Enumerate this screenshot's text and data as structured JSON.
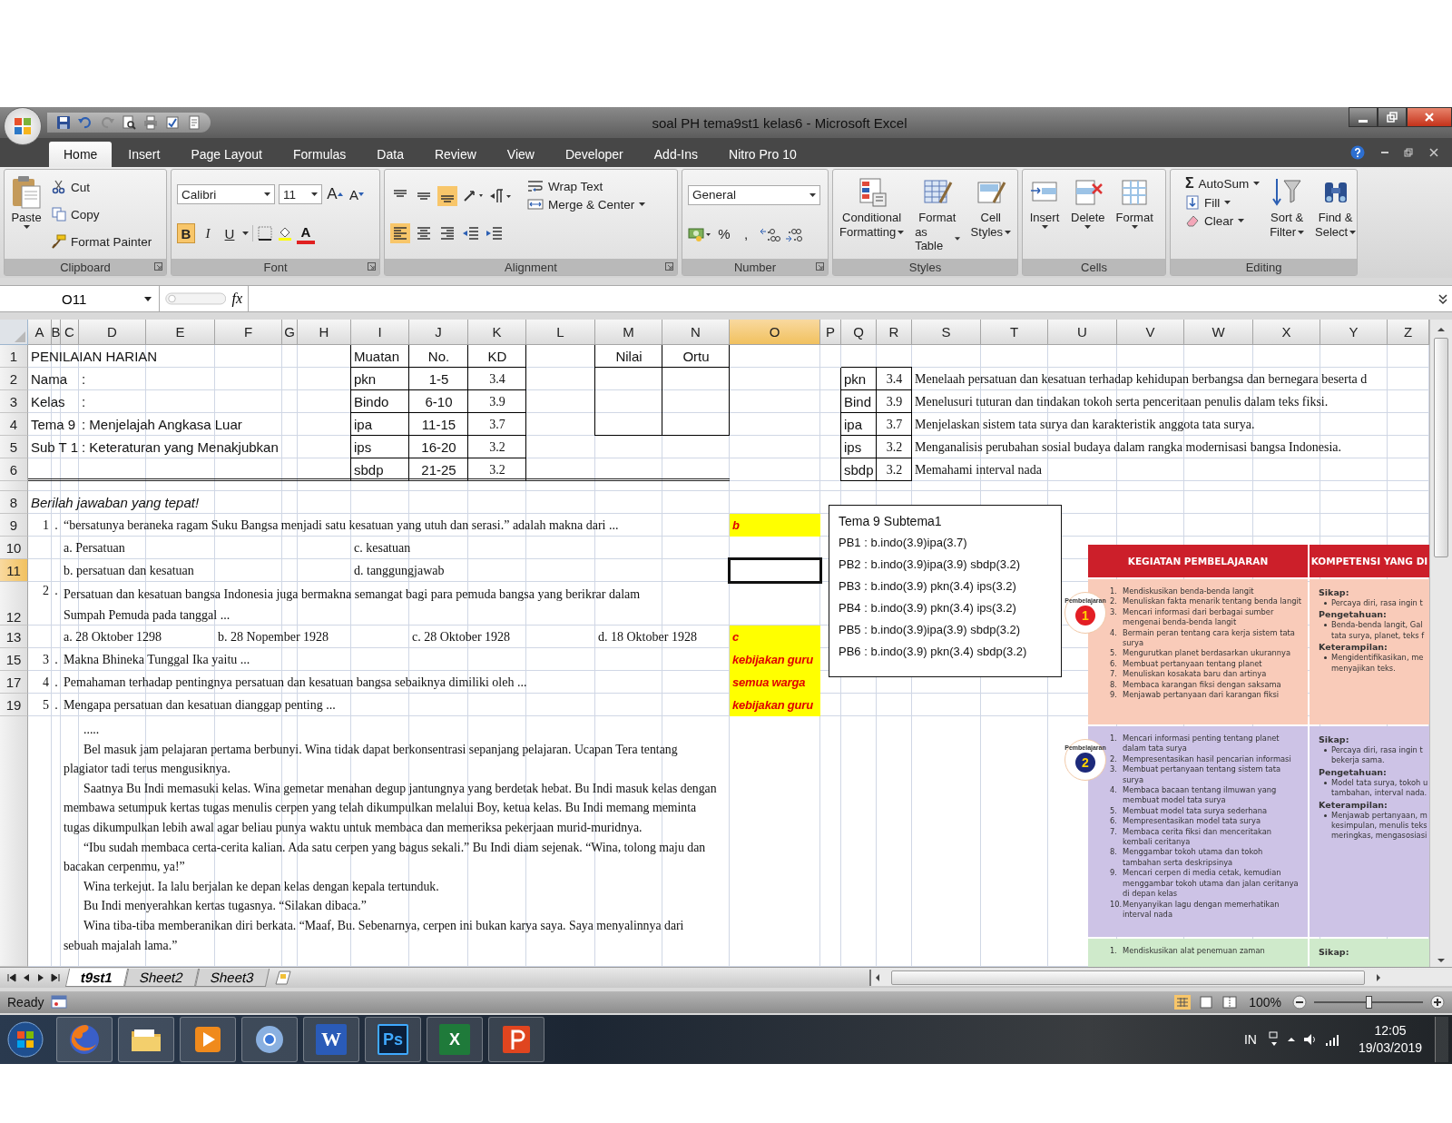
{
  "window": {
    "title": "soal PH tema9st1 kelas6 - Microsoft Excel"
  },
  "ribbon_tabs": [
    {
      "label": "Home",
      "selected": true
    },
    {
      "label": "Insert",
      "selected": false
    },
    {
      "label": "Page Layout",
      "selected": false
    },
    {
      "label": "Formulas",
      "selected": false
    },
    {
      "label": "Data",
      "selected": false
    },
    {
      "label": "Review",
      "selected": false
    },
    {
      "label": "View",
      "selected": false
    },
    {
      "label": "Developer",
      "selected": false
    },
    {
      "label": "Add-Ins",
      "selected": false
    },
    {
      "label": "Nitro Pro 10",
      "selected": false
    }
  ],
  "ribbon": {
    "clipboard": {
      "title": "Clipboard",
      "paste": "Paste",
      "cut": "Cut",
      "copy": "Copy",
      "format_painter": "Format Painter"
    },
    "font": {
      "title": "Font",
      "family": "Calibri",
      "size": "11",
      "grow": "A",
      "shrink": "A",
      "bold": {
        "glyph": "B",
        "on": true
      },
      "italic": {
        "glyph": "I",
        "on": false
      },
      "underline": {
        "glyph": "U",
        "on": false
      },
      "font_color": "A"
    },
    "alignment": {
      "title": "Alignment",
      "vertical": [
        {
          "selected": false
        },
        {
          "selected": false
        },
        {
          "selected": true
        }
      ],
      "horizontal": [
        {
          "selected": true
        },
        {
          "selected": false
        },
        {
          "selected": false
        }
      ],
      "wrap_text": "Wrap Text",
      "merge_center": "Merge & Center"
    },
    "number": {
      "title": "Number",
      "format": "General",
      "percent": "%",
      "comma": ","
    },
    "styles": {
      "title": "Styles",
      "buttons": [
        {
          "lines": [
            "Conditional",
            "Formatting"
          ]
        },
        {
          "lines": [
            "Format",
            "as Table"
          ]
        },
        {
          "lines": [
            "Cell",
            "Styles"
          ]
        }
      ]
    },
    "cells": {
      "title": "Cells",
      "buttons": [
        "Insert",
        "Delete",
        "Format"
      ]
    },
    "editing": {
      "title": "Editing",
      "autosum_glyph": "Σ",
      "autosum": "AutoSum",
      "fill": "Fill",
      "clear": "Clear",
      "sort": [
        "Sort &",
        "Filter"
      ],
      "find": [
        "Find &",
        "Select"
      ]
    }
  },
  "formula_bar": {
    "name_box": "O11",
    "function_glyph": "fx"
  },
  "sheet": {
    "columns": [
      {
        "label": "A",
        "selected": false
      },
      {
        "label": "B",
        "selected": false
      },
      {
        "label": "C",
        "selected": false
      },
      {
        "label": "D",
        "selected": false
      },
      {
        "label": "E",
        "selected": false
      },
      {
        "label": "F",
        "selected": false
      },
      {
        "label": "G",
        "selected": false
      },
      {
        "label": "H",
        "selected": false
      },
      {
        "label": "I",
        "selected": false
      },
      {
        "label": "J",
        "selected": false
      },
      {
        "label": "K",
        "selected": false
      },
      {
        "label": "L",
        "selected": false
      },
      {
        "label": "M",
        "selected": false
      },
      {
        "label": "N",
        "selected": false
      },
      {
        "label": "O",
        "selected": true
      },
      {
        "label": "P",
        "selected": false
      },
      {
        "label": "Q",
        "selected": false
      },
      {
        "label": "R",
        "selected": false
      },
      {
        "label": "S",
        "selected": false
      },
      {
        "label": "T",
        "selected": false
      },
      {
        "label": "U",
        "selected": false
      },
      {
        "label": "V",
        "selected": false
      },
      {
        "label": "W",
        "selected": false
      },
      {
        "label": "X",
        "selected": false
      },
      {
        "label": "Y",
        "selected": false
      },
      {
        "label": "Z",
        "selected": false
      }
    ],
    "rows": [
      {
        "label": "1",
        "selected": false,
        "kind": "normal",
        "cells": {
          "A": {
            "kind": "label",
            "text": "PENILAIAN HARIAN"
          },
          "I": {
            "kind": "label",
            "text": "Muatan"
          },
          "J": {
            "kind": "value",
            "text": "No."
          },
          "K": {
            "kind": "value",
            "text": "KD"
          },
          "M": {
            "kind": "value",
            "text": "Nilai"
          },
          "N": {
            "kind": "value",
            "text": "Ortu"
          }
        }
      },
      {
        "label": "2",
        "selected": false,
        "kind": "normal",
        "cells": {
          "A": {
            "kind": "label",
            "text": "Nama"
          },
          "D": {
            "kind": "label",
            "text": ":"
          },
          "I": {
            "kind": "label",
            "text": "pkn"
          },
          "J": {
            "kind": "value",
            "text": "1-5"
          },
          "K": {
            "kind": "serif_value",
            "text": "3.4"
          },
          "Q": {
            "kind": "label",
            "text": "pkn"
          },
          "R": {
            "kind": "serif_value",
            "text": "3.4"
          },
          "S": {
            "kind": "serif_text",
            "text": "Menelaah persatuan dan kesatuan terhadap kehidupan berbangsa dan bernegara beserta d"
          }
        }
      },
      {
        "label": "3",
        "selected": false,
        "kind": "normal",
        "cells": {
          "A": {
            "kind": "label",
            "text": "Kelas"
          },
          "D": {
            "kind": "label",
            "text": ":"
          },
          "I": {
            "kind": "label",
            "text": "Bindo"
          },
          "J": {
            "kind": "value",
            "text": "6-10"
          },
          "K": {
            "kind": "serif_value",
            "text": "3.9"
          },
          "Q": {
            "kind": "label",
            "text": "Bind"
          },
          "R": {
            "kind": "serif_value",
            "text": "3.9"
          },
          "S": {
            "kind": "serif_text",
            "text": "Menelusuri tuturan dan tindakan tokoh serta penceritaan penulis dalam teks fiksi."
          }
        }
      },
      {
        "label": "4",
        "selected": false,
        "kind": "normal",
        "cells": {
          "A": {
            "kind": "label",
            "text": "Tema 9"
          },
          "D": {
            "kind": "label",
            "text": ": Menjelajah Angkasa Luar"
          },
          "I": {
            "kind": "label",
            "text": "ipa"
          },
          "J": {
            "kind": "value",
            "text": "11-15"
          },
          "K": {
            "kind": "serif_value",
            "text": "3.7"
          },
          "Q": {
            "kind": "label",
            "text": "ipa"
          },
          "R": {
            "kind": "serif_value",
            "text": "3.7"
          },
          "S": {
            "kind": "serif_text",
            "text": "Menjelaskan sistem tata surya dan karakteristik anggota tata surya."
          }
        }
      },
      {
        "label": "5",
        "selected": false,
        "kind": "normal",
        "cells": {
          "A": {
            "kind": "label",
            "text": "Sub T 1"
          },
          "D": {
            "kind": "label",
            "text": ": Keteraturan yang Menakjubkan"
          },
          "I": {
            "kind": "label",
            "text": "ips"
          },
          "J": {
            "kind": "value",
            "text": "16-20"
          },
          "K": {
            "kind": "serif_value",
            "text": "3.2"
          },
          "Q": {
            "kind": "label",
            "text": "ips"
          },
          "R": {
            "kind": "serif_value",
            "text": "3.2"
          },
          "S": {
            "kind": "serif_text",
            "text": "Menganalisis perubahan sosial budaya dalam rangka modernisasi bangsa Indonesia."
          }
        }
      },
      {
        "label": "6",
        "selected": false,
        "kind": "normal",
        "cells": {
          "I": {
            "kind": "label",
            "text": "sbdp"
          },
          "J": {
            "kind": "value",
            "text": "21-25"
          },
          "K": {
            "kind": "serif_value",
            "text": "3.2"
          },
          "Q": {
            "kind": "label",
            "text": "sbdp"
          },
          "R": {
            "kind": "serif_value",
            "text": "3.2"
          },
          "S": {
            "kind": "serif_text",
            "text": "Memahami interval nada"
          }
        }
      },
      {
        "selected": false,
        "kind": "spacer"
      },
      {
        "label": "8",
        "selected": false,
        "kind": "normal",
        "cells": {
          "A": {
            "kind": "instruction",
            "text": "Berilah jawaban yang tepat!"
          }
        }
      },
      {
        "label": "9",
        "selected": false,
        "kind": "normal",
        "cells": {
          "A": {
            "kind": "num",
            "text": "1"
          },
          "B": {
            "kind": "dot",
            "text": "."
          },
          "C": {
            "kind": "serif_text",
            "text": "“bersatunya beraneka ragam Suku Bangsa menjadi satu kesatuan yang utuh dan serasi.”  adalah makna dari ..."
          },
          "O": {
            "kind": "answer",
            "text": "b"
          }
        }
      },
      {
        "label": "10",
        "selected": false,
        "kind": "normal",
        "cells": {
          "C": {
            "kind": "serif_text",
            "text": "a. Persatuan"
          },
          "I": {
            "kind": "serif_text",
            "text": "c. kesatuan"
          }
        }
      },
      {
        "label": "11",
        "selected": true,
        "kind": "normal",
        "cells": {
          "C": {
            "kind": "serif_text",
            "text": "b. persatuan dan kesatuan"
          },
          "I": {
            "kind": "serif_text",
            "text": "d. tanggungjawab"
          }
        }
      },
      {
        "label": "12",
        "selected": false,
        "kind": "double",
        "cells": {
          "A": {
            "kind": "num",
            "text": "2"
          },
          "B": {
            "kind": "dot",
            "text": "."
          },
          "C": {
            "kind": "wrap",
            "lines": [
              "Persatuan dan kesatuan bangsa Indonesia juga bermakna semangat bagi para pemuda bangsa yang berikrar dalam",
              "Sumpah Pemuda pada tanggal ..."
            ]
          }
        }
      },
      {
        "label": "13",
        "selected": false,
        "kind": "normal",
        "cells": {
          "C": {
            "kind": "serif_text",
            "text": "a. 28 Oktober 1298"
          },
          "F": {
            "kind": "serif_text",
            "text": "b. 28 Nopember 1928"
          },
          "J": {
            "kind": "serif_text",
            "text": "c. 28 Oktober 1928"
          },
          "M": {
            "kind": "serif_text",
            "text": "d. 18 Oktober 1928"
          },
          "O": {
            "kind": "answer",
            "text": "c"
          }
        }
      },
      {
        "label": "15",
        "selected": false,
        "kind": "normal",
        "cells": {
          "A": {
            "kind": "num",
            "text": "3"
          },
          "B": {
            "kind": "dot",
            "text": "."
          },
          "C": {
            "kind": "serif_text",
            "text": "Makna Bhineka Tunggal Ika yaitu ..."
          },
          "O": {
            "kind": "answer",
            "text": "kebijakan guru"
          }
        }
      },
      {
        "label": "17",
        "selected": false,
        "kind": "normal",
        "cells": {
          "A": {
            "kind": "num",
            "text": "4"
          },
          "B": {
            "kind": "dot",
            "text": "."
          },
          "C": {
            "kind": "serif_text",
            "text": "Pemahaman terhadap pentingnya persatuan dan kesatuan bangsa sebaiknya dimiliki oleh ..."
          },
          "O": {
            "kind": "answer",
            "text": "semua warga"
          }
        }
      },
      {
        "label": "19",
        "selected": false,
        "kind": "normal",
        "cells": {
          "A": {
            "kind": "num",
            "text": "5"
          },
          "B": {
            "kind": "dot",
            "text": "."
          },
          "C": {
            "kind": "serif_text",
            "text": "Mengapa persatuan dan kesatuan dianggap penting ..."
          },
          "O": {
            "kind": "answer",
            "text": "kebijakan guru"
          }
        }
      },
      {
        "selected": false,
        "kind": "passage",
        "cells": {
          "C": {
            "kind": "passage",
            "paragraphs": [
              {
                "lines": [
                  "....."
                ]
              },
              {
                "lines": [
                  "Bel masuk jam pelajaran pertama berbunyi.  Wina tidak dapat berkonsentrasi sepanjang pelajaran. Ucapan Tera tentang",
                  "plagiator tadi terus mengusiknya."
                ]
              },
              {
                "lines": [
                  "Saatnya Bu Indi memasuki kelas. Wina gemetar menahan degup jantungnya yang berdetak hebat. Bu Indi masuk kelas dengan",
                  "membawa setumpuk kertas tugas menulis cerpen yang telah dikumpulkan melalui Boy, ketua kelas. Bu Indi memang meminta",
                  "tugas  dikumpulkan lebih awal agar beliau punya waktu untuk membaca dan memeriksa pekerjaan murid-muridnya."
                ]
              },
              {
                "lines": [
                  "“Ibu sudah membaca certa-cerita kalian. Ada satu cerpen yang bagus sekali.” Bu Indi diam sejenak.  “Wina, tolong maju dan",
                  "bacakan cerpenmu, ya!”"
                ]
              },
              {
                "lines": [
                  "Wina terkejut.  Ia lalu berjalan ke depan kelas dengan kepala tertunduk."
                ]
              },
              {
                "lines": [
                  "Bu Indi menyerahkan kertas tugasnya. “Silakan dibaca.”"
                ]
              },
              {
                "lines": [
                  "Wina tiba-tiba memberanikan diri berkata. “Maaf, Bu.  Sebenarnya, cerpen ini bukan karya saya.  Saya menyalinnya dari",
                  "sebuah majalah lama.”"
                ]
              }
            ]
          }
        }
      }
    ]
  },
  "text_box": {
    "title": "Tema 9 Subtema1",
    "lines": [
      "PB1 : b.indo(3.9)ipa(3.7)",
      "PB2 : b.indo(3.9)ipa(3.9) sbdp(3.2)",
      "PB3 : b.indo(3.9) pkn(3.4) ips(3.2)",
      "PB4 : b.indo(3.9) pkn(3.4) ips(3.2)",
      "PB5 : b.indo(3.9)ipa(3.9) sbdp(3.2)",
      "PB6 : b.indo(3.9) pkn(3.4) sbdp(3.2)"
    ]
  },
  "picture": {
    "headers": [
      "KEGIATAN PEMBELAJARAN",
      "KOMPETENSI YANG DI"
    ],
    "sections": [
      {
        "color": "#f9cbb9",
        "badge": {
          "number": "1",
          "label": "Pembelajaran",
          "color": "#e31e24"
        },
        "activities": [
          {
            "number": "1.",
            "text": "Mendiskusikan benda-benda langit"
          },
          {
            "number": "2.",
            "text": "Menuliskan fakta menarik tentang benda langit"
          },
          {
            "number": "3.",
            "text": "Mencari informasi dari berbagai sumber mengenai benda-benda langit"
          },
          {
            "number": "4.",
            "text": "Bermain peran tentang cara kerja sistem tata surya"
          },
          {
            "number": "5.",
            "text": "Mengurutkan planet berdasarkan ukurannya"
          },
          {
            "number": "6.",
            "text": "Membuat pertanyaan tentang planet"
          },
          {
            "number": "7.",
            "text": "Menuliskan kosakata baru dan artinya"
          },
          {
            "number": "8.",
            "text": "Membaca karangan fiksi dengan saksama"
          },
          {
            "number": "9.",
            "text": "Menjawab pertanyaan dari karangan fiksi"
          }
        ],
        "competencies": [
          {
            "heading": "Sikap:",
            "items": [
              [
                "Percaya diri, rasa ingin t"
              ]
            ]
          },
          {
            "heading": "Pengetahuan:",
            "items": [
              [
                "Benda-benda langit, Gal",
                "tata surya, planet, teks f"
              ]
            ]
          },
          {
            "heading": "Keterampilan:",
            "items": [
              [
                "Mengidentifikasikan, me",
                "menyajikan teks."
              ]
            ]
          }
        ]
      },
      {
        "color": "#cdc3e6",
        "badge": {
          "number": "2",
          "label": "Pembelajaran",
          "color": "#1d2a7a"
        },
        "activities": [
          {
            "number": "1.",
            "text": "Mencari informasi penting tentang planet dalam tata surya"
          },
          {
            "number": "2.",
            "text": "Mempresentasikan hasil pencarian informasi"
          },
          {
            "number": "3.",
            "text": "Membuat pertanyaan tentang sistem tata surya"
          },
          {
            "number": "4.",
            "text": "Membaca bacaan tentang ilmuwan yang membuat model tata surya"
          },
          {
            "number": "5.",
            "text": "Membuat model tata surya sederhana"
          },
          {
            "number": "6.",
            "text": "Mempresentasikan model tata surya"
          },
          {
            "number": "7.",
            "text": "Membaca cerita fiksi dan menceritakan kembali ceritanya"
          },
          {
            "number": "8.",
            "text": "Menggambar tokoh utama dan tokoh tambahan serta deskripsinya"
          },
          {
            "number": "9.",
            "text": "Mencari cerpen di media cetak, kemudian menggambar tokoh utama dan jalan ceritanya di depan kelas"
          },
          {
            "number": "10.",
            "text": "Menyanyikan lagu dengan memerhatikan interval nada"
          }
        ],
        "competencies": [
          {
            "heading": "Sikap:",
            "items": [
              [
                "Percaya diri, rasa ingin t",
                "bekerja sama."
              ]
            ]
          },
          {
            "heading": "Pengetahuan:",
            "items": [
              [
                "Model tata surya, tokoh u",
                "tambahan, interval nada."
              ]
            ]
          },
          {
            "heading": "Keterampilan:",
            "items": [
              [
                "Menjawab pertanyaan, m",
                "kesimpulan, menulis teks",
                "meringkas, mengasosiasi"
              ]
            ]
          }
        ]
      },
      {
        "color": "#cfeacb",
        "activities": [
          {
            "number": "1.",
            "text": "Mendiskusikan alat penemuan zaman"
          }
        ],
        "competencies": [
          {
            "heading": "Sikap:"
          }
        ]
      }
    ]
  },
  "sheet_tabs": [
    {
      "label": "t9st1",
      "selected": true
    },
    {
      "label": "Sheet2",
      "selected": false
    },
    {
      "label": "Sheet3",
      "selected": false
    }
  ],
  "status_bar": {
    "status": "Ready",
    "zoom": "100%",
    "zoom_slider": {
      "level": 0.5
    }
  },
  "taskbar": {
    "apps": [
      {
        "kind": "firefox"
      },
      {
        "kind": "folder"
      },
      {
        "kind": "media"
      },
      {
        "kind": "chrome"
      },
      {
        "kind": "word",
        "glyph": "W"
      },
      {
        "kind": "photoshop",
        "glyph": "Ps"
      },
      {
        "kind": "excel",
        "glyph": "X"
      },
      {
        "kind": "pdf"
      }
    ],
    "language": "IN",
    "time": "12:05",
    "date": "19/03/2019"
  }
}
